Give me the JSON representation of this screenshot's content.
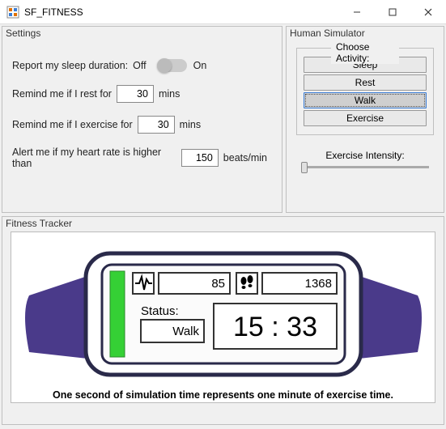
{
  "window": {
    "title": "SF_FITNESS"
  },
  "settings": {
    "title": "Settings",
    "sleep_label_pre": "Report my sleep duration:",
    "off": "Off",
    "on": "On",
    "rest_pre": "Remind me if I rest for",
    "rest_val": "30",
    "rest_post": "mins",
    "ex_pre": "Remind me if I exercise for",
    "ex_val": "30",
    "ex_post": "mins",
    "hr_pre": "Alert me if my heart rate is higher than",
    "hr_val": "150",
    "hr_post": "beats/min"
  },
  "sim": {
    "title": "Human Simulator",
    "choose": "Choose Activity:",
    "activities": [
      "Sleep",
      "Rest",
      "Walk",
      "Exercise"
    ],
    "selected": "Walk",
    "intensity_label": "Exercise Intensity:"
  },
  "tracker": {
    "title": "Fitness Tracker",
    "hr_value": "85",
    "steps_value": "1368",
    "status_label": "Status:",
    "status_value": "Walk",
    "time_value": "15 : 33",
    "caption": "One second of simulation time represents one minute of exercise time.",
    "icons": {
      "heart": "heart-rate-icon",
      "steps": "footsteps-icon"
    }
  }
}
